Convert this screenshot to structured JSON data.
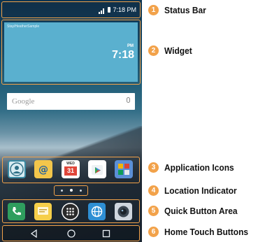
{
  "status_bar": {
    "time": "7:18 PM"
  },
  "widget": {
    "small_text": "Stay/HeatherSample",
    "pm": "PM",
    "time": "7:18"
  },
  "search": {
    "label": "Google"
  },
  "app_icons": [
    {
      "icon": "contacts-icon",
      "color": "#d9ecf2"
    },
    {
      "icon": "email-icon",
      "color": "#f3c64b"
    },
    {
      "icon": "calendar-icon",
      "color": "#ffffff",
      "day": "WED",
      "date": "31"
    },
    {
      "icon": "play-store-icon",
      "color": "#ffffff"
    },
    {
      "icon": "apps-folder-icon",
      "color": "#5b8fd6"
    }
  ],
  "quick_buttons": [
    {
      "icon": "phone-icon",
      "color": "#2f9e5e"
    },
    {
      "icon": "messages-icon",
      "color": "#f6cf4a"
    },
    {
      "icon": "apps-drawer-icon",
      "color": "#ffffff"
    },
    {
      "icon": "browser-icon",
      "color": "#2e8fd4"
    },
    {
      "icon": "camera-icon",
      "color": "#cfd6de"
    }
  ],
  "home_buttons": [
    "back-icon",
    "home-icon",
    "recents-icon"
  ],
  "callouts": [
    {
      "number": "1",
      "label": "Status Bar"
    },
    {
      "number": "2",
      "label": "Widget"
    },
    {
      "number": "3",
      "label": "Application Icons"
    },
    {
      "number": "4",
      "label": "Location Indicator"
    },
    {
      "number": "5",
      "label": "Quick Button Area"
    },
    {
      "number": "6",
      "label": "Home Touch Buttons"
    }
  ],
  "accent_color": "#f2a24a"
}
